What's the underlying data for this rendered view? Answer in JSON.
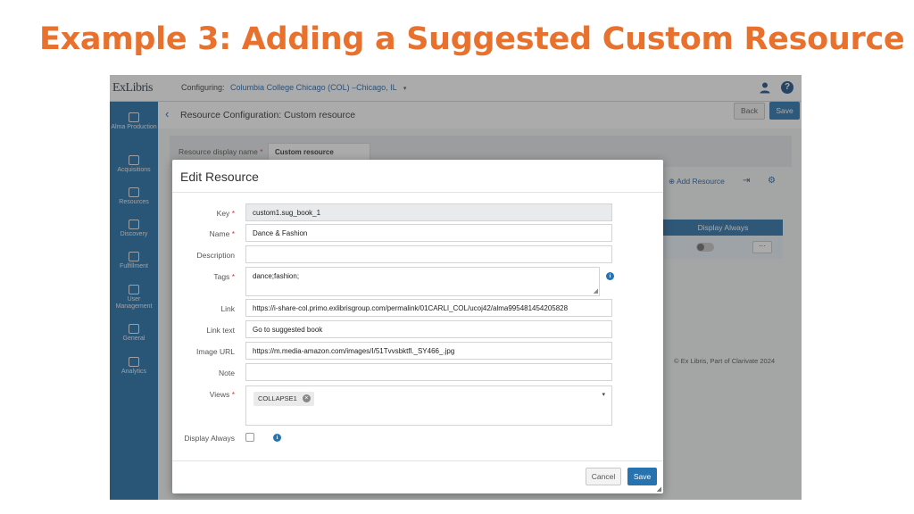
{
  "slide": {
    "title": "Example 3: Adding a Suggested Custom Resource"
  },
  "app": {
    "logo": "ExLibris",
    "configuring_label": "Configuring:",
    "institution": "Columbia College Chicago (COL) –Chicago, IL",
    "caret": "▾",
    "help": "?"
  },
  "sidebar": {
    "items": [
      {
        "label": "Alma Production",
        "icon": "alma-icon"
      },
      {
        "label": "Acquisitions",
        "icon": "acquisitions-icon"
      },
      {
        "label": "Resources",
        "icon": "resources-icon"
      },
      {
        "label": "Discovery",
        "icon": "discovery-icon"
      },
      {
        "label": "Fulfillment",
        "icon": "fulfillment-icon"
      },
      {
        "label": "User Management",
        "icon": "user-management-icon"
      },
      {
        "label": "General",
        "icon": "general-icon"
      },
      {
        "label": "Analytics",
        "icon": "analytics-icon"
      }
    ]
  },
  "page": {
    "back_arrow": "‹",
    "title": "Resource Configuration: Custom resource",
    "back_label": "Back",
    "save_label": "Save",
    "display_name_label": "Resource display name",
    "required_mark": "*",
    "display_name_value": "Custom resource",
    "add_resource_label": "⊕ Add Resource",
    "export_icon": "⇥",
    "settings_icon": "⚙",
    "table_header": "Display Always",
    "row_actions": "···",
    "footer": "© Ex Libris, Part of Clarivate  2024"
  },
  "modal": {
    "title": "Edit Resource",
    "fields": {
      "key": {
        "label": "Key",
        "value": "custom1.sug_book_1"
      },
      "name": {
        "label": "Name",
        "value": "Dance & Fashion"
      },
      "description": {
        "label": "Description",
        "value": ""
      },
      "tags": {
        "label": "Tags",
        "value": "dance;fashion;"
      },
      "link": {
        "label": "Link",
        "value": "https://i-share-col.primo.exlibrisgroup.com/permalink/01CARLI_COL/ucoj42/alma995481454205828"
      },
      "link_text": {
        "label": "Link text",
        "value": "Go to suggested book"
      },
      "image_url": {
        "label": "Image URL",
        "value": "https://m.media-amazon.com/images/I/51Tvvsbktfl._SY466_.jpg"
      },
      "note": {
        "label": "Note",
        "value": ""
      },
      "views": {
        "label": "Views",
        "chip": "COLLAPSE1"
      },
      "display_always": {
        "label": "Display Always",
        "checked": false
      }
    },
    "info": "i",
    "chip_remove": "×",
    "dropdown_caret": "▾",
    "cancel_label": "Cancel",
    "save_label": "Save"
  },
  "colors": {
    "title_orange": "#e8712d",
    "sidebar_blue": "#1f6da5",
    "primary_button": "#2673b0",
    "required_red": "#dd3333"
  }
}
